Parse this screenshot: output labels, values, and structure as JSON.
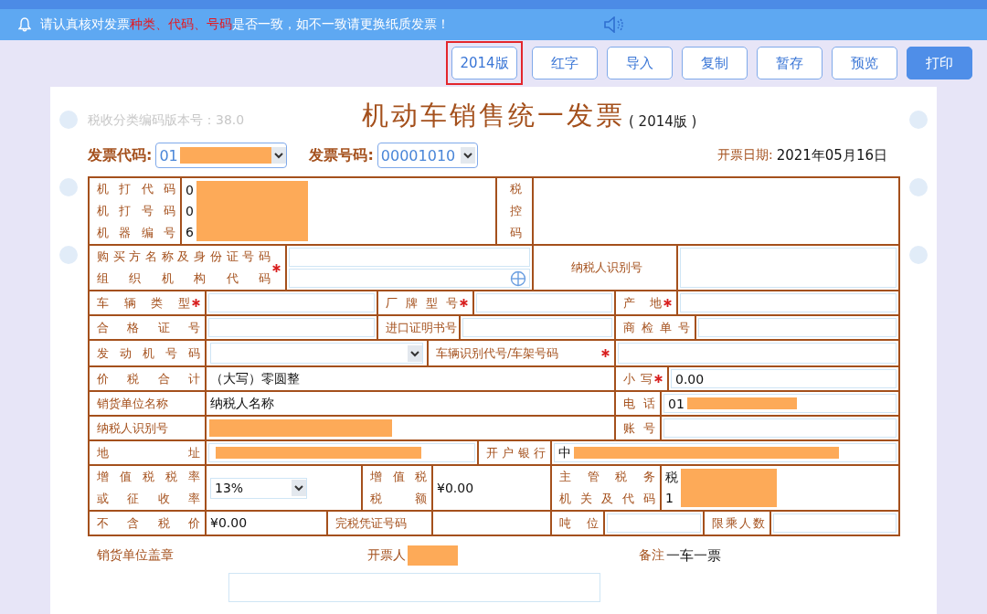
{
  "notice": {
    "segments": [
      {
        "text": "请认真核对发票",
        "highlight": false
      },
      {
        "text": "种类、代码、号码",
        "highlight": true
      },
      {
        "text": "是否一致，如不一致请更换纸质发票！",
        "highlight": false
      }
    ]
  },
  "toolbar": [
    {
      "label": "2014版",
      "primary": false,
      "highlighted": true
    },
    {
      "label": "红字",
      "primary": false
    },
    {
      "label": "导入",
      "primary": false
    },
    {
      "label": "复制",
      "primary": false
    },
    {
      "label": "暂存",
      "primary": false
    },
    {
      "label": "预览",
      "primary": false
    },
    {
      "label": "打印",
      "primary": true
    }
  ],
  "invoice": {
    "version_note": "税收分类编码版本号：38.0",
    "title": "机动车销售统一发票",
    "edition": "( 2014版 )",
    "code": {
      "label": "发票代码:",
      "value": "01",
      "redacted": true
    },
    "number": {
      "label": "发票号码:",
      "value": "00001010"
    },
    "date": {
      "label": "开票日期:",
      "value": "2021年05月16日"
    }
  },
  "table_rows": [
    {
      "cells": [
        {
          "kind": "label",
          "lines": [
            "机打代码",
            "机打号码",
            "机器编号"
          ]
        },
        {
          "kind": "value",
          "lines": [
            "0",
            "0",
            "6"
          ],
          "redacted": true
        },
        {
          "kind": "label",
          "lines": [
            "税",
            "控",
            "码"
          ]
        },
        {
          "kind": "blank"
        }
      ]
    },
    {
      "cells": [
        {
          "kind": "label",
          "lines": [
            "购买方名称及身份证号码",
            "组织机构代码"
          ],
          "required": true
        },
        {
          "kind": "field_stack",
          "fields": [
            {
              "picker": false
            },
            {
              "picker": true
            }
          ]
        },
        {
          "kind": "label",
          "lines": [
            "纳税人识别号"
          ]
        },
        {
          "kind": "field"
        }
      ]
    },
    {
      "cells": [
        {
          "kind": "label",
          "lines": [
            "车辆类型"
          ],
          "required": true
        },
        {
          "kind": "field"
        },
        {
          "kind": "label",
          "lines": [
            "厂牌型号"
          ],
          "required": true
        },
        {
          "kind": "field"
        },
        {
          "kind": "label",
          "lines": [
            "产地"
          ],
          "required": true
        },
        {
          "kind": "field"
        }
      ]
    },
    {
      "cells": [
        {
          "kind": "label",
          "lines": [
            "合格证号"
          ]
        },
        {
          "kind": "field"
        },
        {
          "kind": "label",
          "lines": [
            "进口证明书号"
          ]
        },
        {
          "kind": "field"
        },
        {
          "kind": "label",
          "lines": [
            "商检单号"
          ]
        },
        {
          "kind": "field"
        }
      ]
    },
    {
      "cells": [
        {
          "kind": "label",
          "lines": [
            "发动机号码"
          ]
        },
        {
          "kind": "select"
        },
        {
          "kind": "label",
          "lines": [
            "车辆识别代号/车架号码"
          ],
          "required": true
        },
        {
          "kind": "field"
        }
      ]
    },
    {
      "cells": [
        {
          "kind": "label",
          "lines": [
            "价税合计"
          ]
        },
        {
          "kind": "value",
          "lines": [
            "（大写）零圆整"
          ]
        },
        {
          "kind": "label",
          "lines": [
            "小写"
          ],
          "required": true
        },
        {
          "kind": "field",
          "value": "0.00"
        }
      ]
    },
    {
      "cells": [
        {
          "kind": "label",
          "lines": [
            "销货单位名称"
          ]
        },
        {
          "kind": "value",
          "lines": [
            "纳税人名称"
          ]
        },
        {
          "kind": "label",
          "lines": [
            "电话"
          ]
        },
        {
          "kind": "field",
          "value": "01",
          "redacted": true
        }
      ]
    },
    {
      "cells": [
        {
          "kind": "label",
          "lines": [
            "纳税人识别号"
          ]
        },
        {
          "kind": "value",
          "redacted": true
        },
        {
          "kind": "label",
          "lines": [
            "账号"
          ]
        },
        {
          "kind": "field"
        }
      ]
    },
    {
      "cells": [
        {
          "kind": "label",
          "lines": [
            "地址"
          ]
        },
        {
          "kind": "field",
          "redacted": true
        },
        {
          "kind": "label",
          "lines": [
            "开户银行"
          ]
        },
        {
          "kind": "field",
          "value": "中",
          "redacted": true
        }
      ]
    },
    {
      "cells": [
        {
          "kind": "label",
          "lines": [
            "增值税税率",
            "或征收率"
          ]
        },
        {
          "kind": "select",
          "value": "13%"
        },
        {
          "kind": "label",
          "lines": [
            "增值税",
            "税额"
          ]
        },
        {
          "kind": "value",
          "lines": [
            "¥0.00"
          ]
        },
        {
          "kind": "label",
          "lines": [
            "主管税务",
            "机关及代码"
          ]
        },
        {
          "kind": "value",
          "lines": [
            "税",
            "1"
          ],
          "redacted": true
        }
      ]
    },
    {
      "cells": [
        {
          "kind": "label",
          "lines": [
            "不含税价"
          ]
        },
        {
          "kind": "value",
          "lines": [
            "¥0.00"
          ]
        },
        {
          "kind": "label",
          "lines": [
            "完税凭证号码"
          ]
        },
        {
          "kind": "value"
        },
        {
          "kind": "label",
          "lines": [
            "吨位"
          ]
        },
        {
          "kind": "field"
        },
        {
          "kind": "label",
          "lines": [
            "限乘人数"
          ]
        },
        {
          "kind": "field"
        }
      ]
    }
  ],
  "footer": [
    {
      "label": "销货单位盖章"
    },
    {
      "label": "开票人",
      "redacted": true
    },
    {
      "label": "备注",
      "value": "一车一票"
    }
  ]
}
